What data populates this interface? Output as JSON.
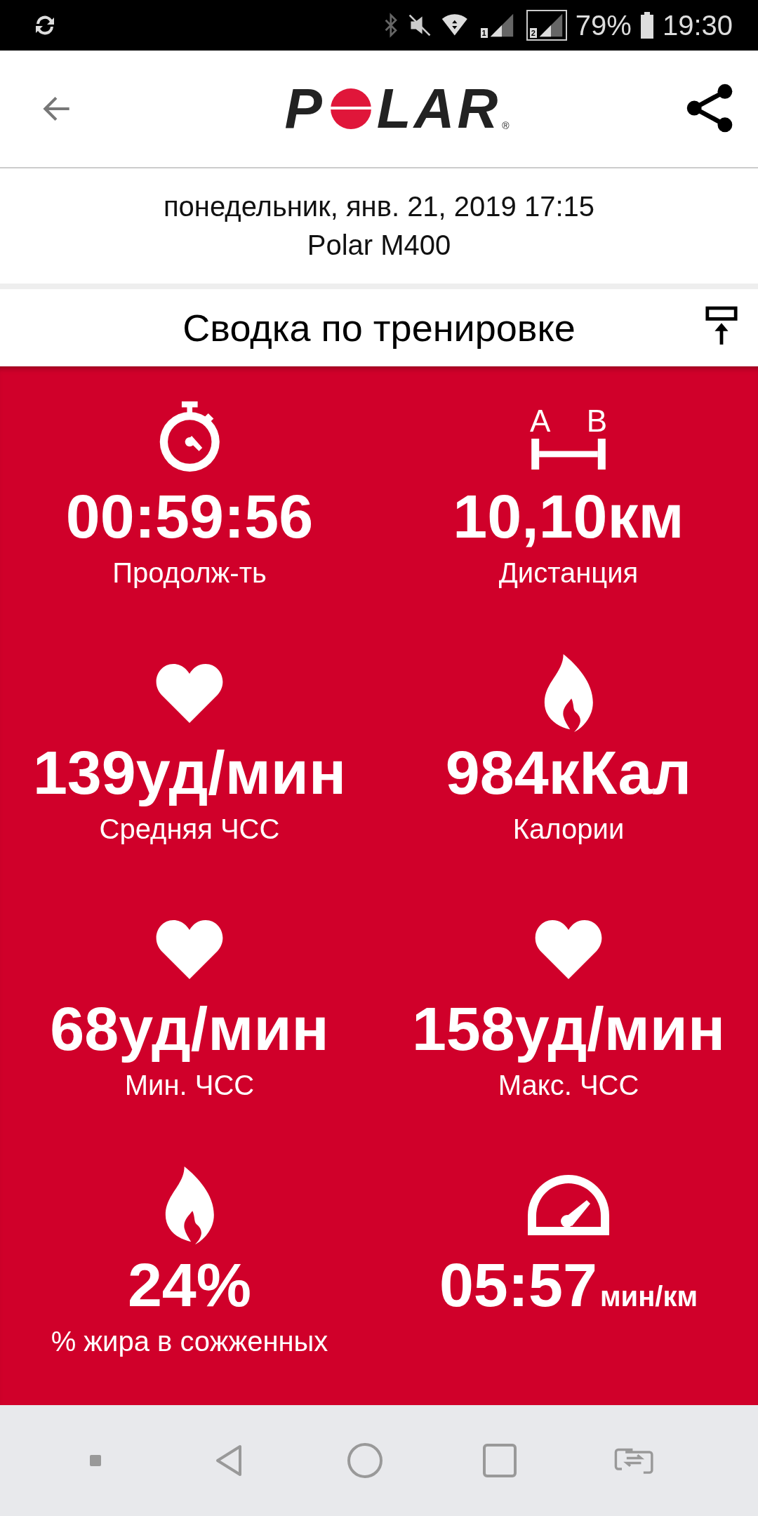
{
  "status_bar": {
    "sim_labels": [
      "1",
      "2"
    ],
    "battery": "79%",
    "time": "19:30"
  },
  "header": {
    "logo": {
      "before": "P",
      "after": "LAR",
      "mark": "®"
    }
  },
  "session": {
    "date": "понедельник, янв. 21, 2019 17:15",
    "device": "Polar M400"
  },
  "section": {
    "title": "Сводка по тренировке"
  },
  "distance_icon": {
    "letters": [
      "A",
      "B"
    ]
  },
  "tiles": [
    {
      "kind": "stopwatch",
      "value": "00:59:56",
      "label": "Продолж-ть"
    },
    {
      "kind": "distance",
      "value": "10,10км",
      "label": "Дистанция"
    },
    {
      "kind": "heart",
      "value": "139уд/мин",
      "label": "Средняя ЧСС"
    },
    {
      "kind": "flame",
      "value": "984кКал",
      "label": "Калории"
    },
    {
      "kind": "heart",
      "value": "68уд/мин",
      "label": "Мин. ЧСС"
    },
    {
      "kind": "heart",
      "value": "158уд/мин",
      "label": "Макс. ЧСС"
    },
    {
      "kind": "flame",
      "value": "24%",
      "label": "% жира в сожженных"
    },
    {
      "kind": "speed",
      "value": "05:57",
      "unit": "мин/км"
    }
  ]
}
